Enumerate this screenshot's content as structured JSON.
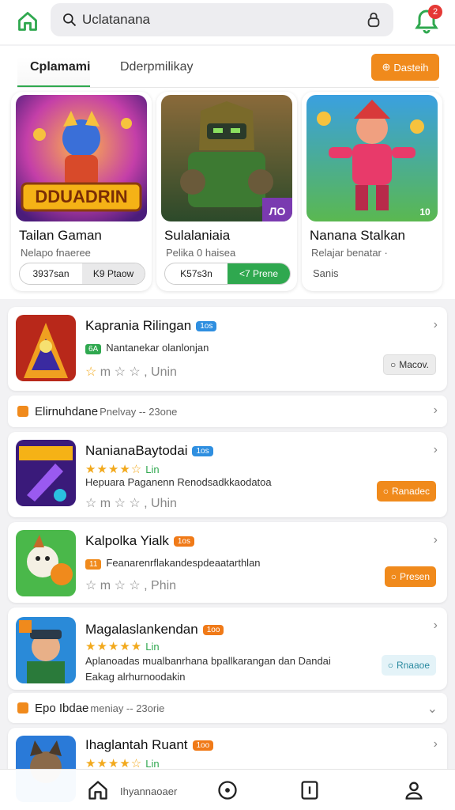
{
  "search": {
    "value": "Uclatanana"
  },
  "notifications": {
    "count": "2"
  },
  "tabs": [
    {
      "label": "Cplamami"
    },
    {
      "label": "Dderpmilikay"
    }
  ],
  "header_button": "Dasteih",
  "featured": [
    {
      "art_text": "DDUADRIN",
      "title": "Tailan Gaman",
      "subtitle": "Nelapo fnaeree",
      "pill_left": "3937san",
      "pill_right": "K9 Ptaow"
    },
    {
      "art_text": "ЛО",
      "title": "Sulalaniaia",
      "subtitle": "Pelika 0 haisea",
      "pill_left": "K57s3n",
      "pill_right": "<7 Prene"
    },
    {
      "art_text": "10",
      "title": "Nanana Stalkan",
      "subtitle": "Relajar benatar ·",
      "plain": "Sanis"
    }
  ],
  "list": [
    {
      "title": "Kaprania Rilingan",
      "chip": "1os",
      "line": "Nantanekar olanlonjan",
      "badge": "6А",
      "stars_label": "m",
      "rating_tail": ", Unin",
      "action": "Macov."
    },
    {
      "strip": true,
      "label": "Elirnuhdane",
      "muted": "Pnelvay -- 23one"
    },
    {
      "title": "NanianaBaytodai",
      "chip": "1os",
      "stars": "★★★★☆",
      "rating": "Lin",
      "line": "Hepuara Paganenn Renodsadkkaodatoa",
      "stars_label": "m",
      "rating_tail": ", Uhin",
      "action": "Ranadec"
    },
    {
      "title": "Kalpolka Yialk",
      "chip": "1os",
      "line": "Feanarenrflakandespdeaatarthlan",
      "badge": "11",
      "stars_label": "m",
      "rating_tail": ", Phin",
      "action": "Presen"
    },
    {
      "title": "Magalaslankendan",
      "chip": "1oo",
      "stars": "★★★★★",
      "rating": "Lin",
      "line": "Aplanoadas mualbanrhana bpallkarangan dan Dandai",
      "line2": "Eakag alrhurnoodakin",
      "action": "Rnaaoe"
    },
    {
      "strip": true,
      "label": "Epo Ibdae",
      "muted": "meniay -- 23orie"
    },
    {
      "title": "Ihaglantah Ruant",
      "chip": "1oo",
      "stars": "★★★★☆",
      "rating": "Lin"
    }
  ],
  "bottom_nav": {
    "label": "Ihyannaoaer"
  },
  "colors": {
    "accent_green": "#2fa84f",
    "accent_orange": "#f08a1c",
    "blue_chip": "#2f8fe0"
  }
}
